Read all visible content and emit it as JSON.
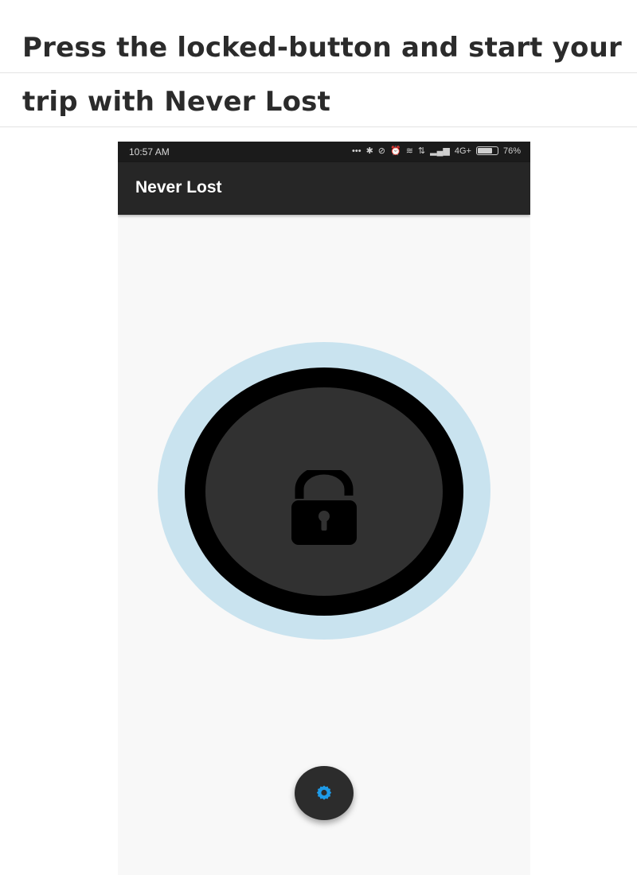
{
  "caption": {
    "line1": "Press the locked-button and start your",
    "line2": "trip with Never Lost"
  },
  "status_bar": {
    "time": "10:57 AM",
    "icons": [
      "more-dots-icon",
      "bluetooth-icon",
      "do-not-disturb-icon",
      "alarm-icon",
      "wifi-icon",
      "data-transfer-icon",
      "signal-icon"
    ],
    "network": "4G+",
    "battery_percent": "76%",
    "battery_level": 0.76
  },
  "app_bar": {
    "title": "Never Lost"
  },
  "lock_button": {
    "icon": "unlocked-padlock-icon",
    "halo_color": "#c9e3ef",
    "ring_color": "#000000",
    "inner_color": "#313131"
  },
  "fab": {
    "icon": "gear-icon",
    "icon_color": "#1e9be8",
    "background": "#2c2c2c"
  }
}
